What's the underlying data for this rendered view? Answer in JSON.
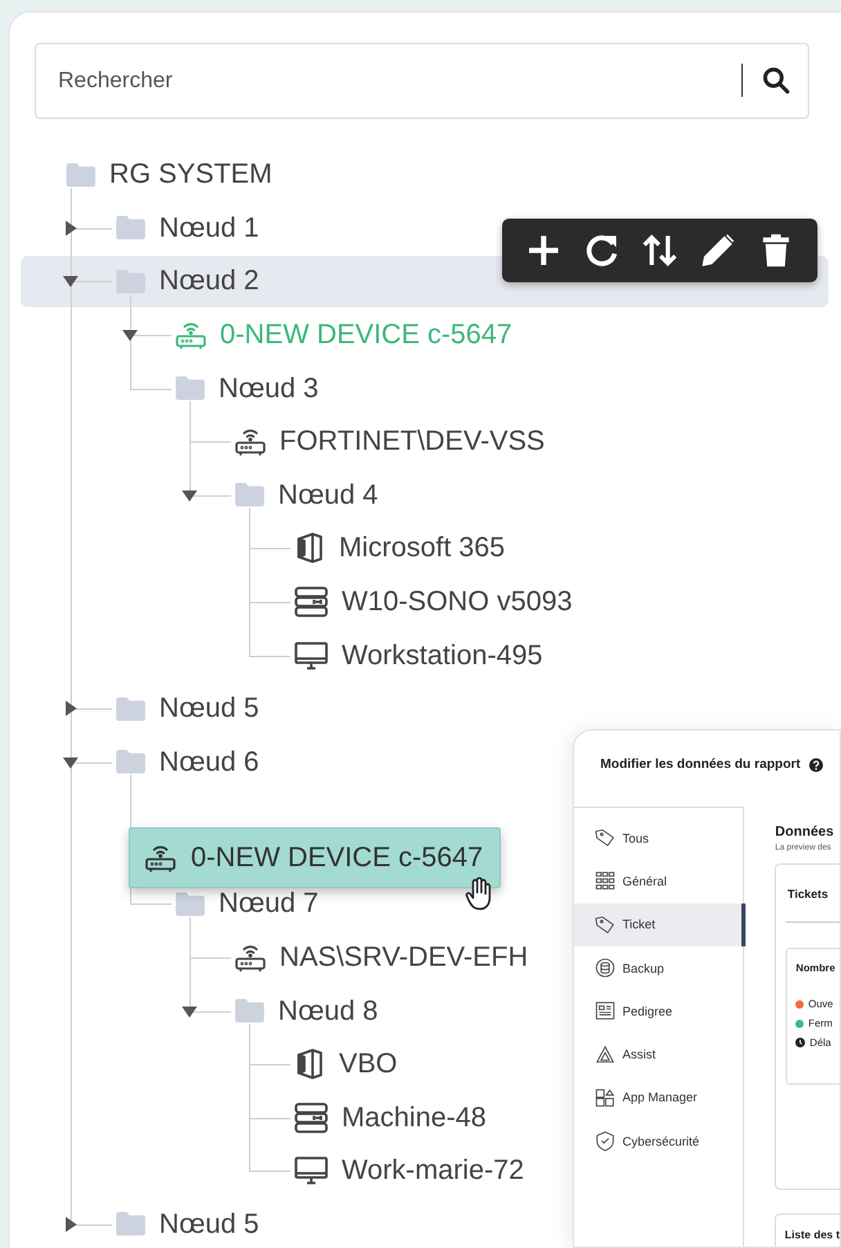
{
  "search": {
    "placeholder": "Rechercher"
  },
  "tree": {
    "label": "RG SYSTEM",
    "kind": "folder",
    "selected": false,
    "children": [
      {
        "label": "Nœud 1",
        "kind": "folder",
        "expanded": false,
        "selected": false
      },
      {
        "label": "Nœud 2",
        "kind": "folder",
        "expanded": true,
        "selected": true,
        "children": [
          {
            "label": "0-NEW DEVICE c-5647",
            "kind": "router",
            "expanded": true,
            "selected": false,
            "color": "#3db87a"
          },
          {
            "label": "Nœud 3",
            "kind": "folder",
            "selected": false,
            "children": [
              {
                "label": "FORTINET\\DEV-VSS",
                "kind": "router",
                "selected": false
              },
              {
                "label": "Nœud 4",
                "kind": "folder",
                "expanded": true,
                "selected": false,
                "children": [
                  {
                    "label": "Microsoft 365",
                    "kind": "office",
                    "selected": false
                  },
                  {
                    "label": "W10-SONO v5093",
                    "kind": "server",
                    "selected": false
                  },
                  {
                    "label": "Workstation-495",
                    "kind": "monitor",
                    "selected": false
                  }
                ]
              }
            ]
          }
        ]
      },
      {
        "label": "Nœud 5",
        "kind": "folder",
        "expanded": false,
        "selected": false
      },
      {
        "label": "Nœud 6",
        "kind": "folder",
        "expanded": true,
        "selected": false,
        "children": [
          {
            "kind": "drop-placeholder"
          },
          {
            "label": "Nœud 7",
            "kind": "folder",
            "selected": false,
            "children": [
              {
                "label": "NAS\\SRV-DEV-EFH",
                "kind": "router",
                "selected": false
              },
              {
                "label": "Nœud 8",
                "kind": "folder",
                "expanded": true,
                "selected": false,
                "children": [
                  {
                    "label": "VBO",
                    "kind": "office",
                    "selected": false
                  },
                  {
                    "label": "Machine-48",
                    "kind": "server",
                    "selected": false
                  },
                  {
                    "label": "Work-marie-72",
                    "kind": "monitor",
                    "selected": false
                  }
                ]
              }
            ]
          }
        ]
      },
      {
        "label": "Nœud 5",
        "kind": "folder",
        "expanded": false,
        "selected": false
      }
    ]
  },
  "node_toolbar": {
    "actions": [
      {
        "kind": "add"
      },
      {
        "kind": "refresh"
      },
      {
        "kind": "sort"
      },
      {
        "kind": "edit"
      },
      {
        "kind": "delete"
      }
    ]
  },
  "drag_preview": {
    "label": "0-NEW DEVICE c-5647",
    "kind": "router"
  },
  "report_panel": {
    "title": "Modifier les données du rapport",
    "nav": [
      {
        "label": "Tous",
        "kind": "tag",
        "selected": false
      },
      {
        "label": "Général",
        "kind": "grid",
        "selected": false
      },
      {
        "label": "Ticket",
        "kind": "tag",
        "selected": true
      },
      {
        "label": "Backup",
        "kind": "database",
        "selected": false
      },
      {
        "label": "Pedigree",
        "kind": "card",
        "selected": false
      },
      {
        "label": "Assist",
        "kind": "assist",
        "selected": false
      },
      {
        "label": "App Manager",
        "kind": "apps",
        "selected": false
      },
      {
        "label": "Cybersécurité",
        "kind": "shield",
        "selected": false
      }
    ],
    "section_title": "Données",
    "section_subtitle": "La preview des",
    "tickets_card": {
      "title": "Tickets",
      "stat_title": "Nombre",
      "legend": [
        {
          "label": "Ouve",
          "kind": "dot",
          "color": "#f26b3a"
        },
        {
          "label": "Ferm",
          "kind": "dot",
          "color": "#3dbb85"
        },
        {
          "label": "Déla",
          "kind": "clock"
        }
      ]
    },
    "list_card_title": "Liste des t"
  }
}
